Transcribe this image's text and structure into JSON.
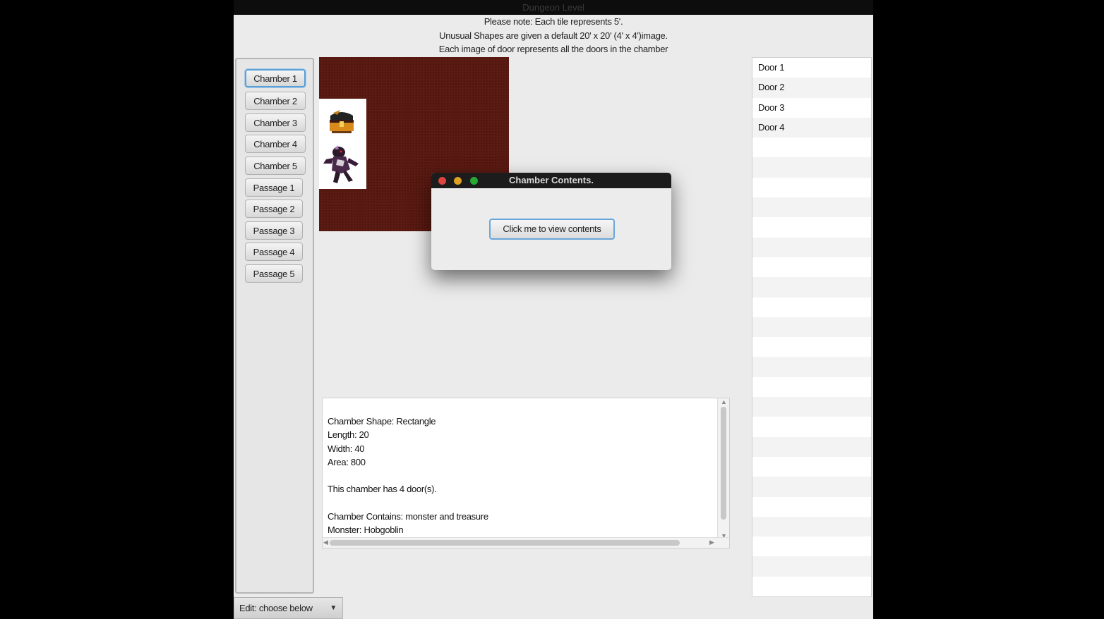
{
  "window": {
    "title": "Dungeon Level"
  },
  "notes": [
    "Please note: Each tile represents 5'.",
    "Unusual Shapes are given a default 20' x 20' (4' x 4')image.",
    "Each image of door represents all the doors in the chamber"
  ],
  "sidebar": {
    "items": [
      {
        "label": "Chamber 1",
        "selected": true
      },
      {
        "label": "Chamber 2"
      },
      {
        "label": "Chamber 3"
      },
      {
        "label": "Chamber 4"
      },
      {
        "label": "Chamber 5"
      },
      {
        "label": "Passage 1"
      },
      {
        "label": "Passage 2"
      },
      {
        "label": "Passage 3"
      },
      {
        "label": "Passage 4"
      },
      {
        "label": "Passage 5"
      }
    ]
  },
  "map": {
    "icons": [
      "treasure-chest-icon",
      "monster-icon"
    ],
    "floor_color": "#5b1a12"
  },
  "dialog": {
    "title": "Chamber Contents.",
    "button_label": "Click me to view contents"
  },
  "description": {
    "lines": [
      "Chamber Shape: Rectangle",
      "Length: 20",
      "Width: 40",
      "Area: 800",
      "",
      "This chamber has 4 door(s).",
      "",
      "Chamber Contains: monster and treasure",
      "Monster: Hobgoblin"
    ]
  },
  "doors": [
    "Door 1",
    "Door 2",
    "Door 3",
    "Door 4"
  ],
  "edit_combo": {
    "selected": "Edit: choose below"
  }
}
